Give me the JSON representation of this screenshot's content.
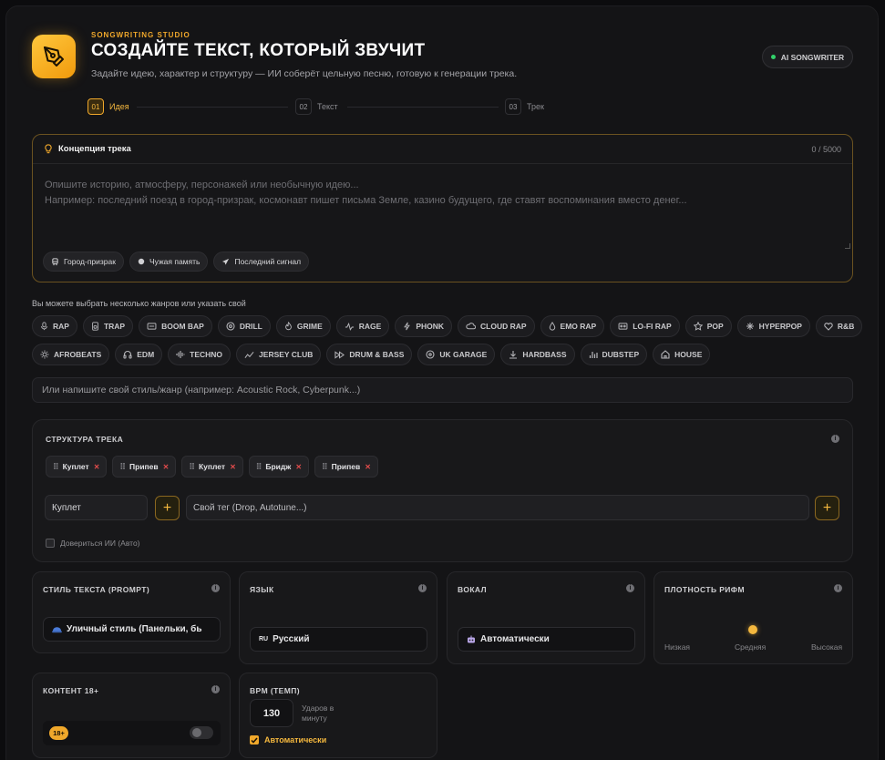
{
  "header": {
    "kicker": "SONGWRITING STUDIO",
    "title": "СОЗДАЙТЕ ТЕКСТ, КОТОРЫЙ ЗВУЧИТ",
    "subtitle": "Задайте идею, характер и структуру — ИИ соберёт цельную песню, готовую к генерации трека.",
    "badge": "AI SONGWRITER"
  },
  "steps": [
    {
      "num": "01",
      "label": "Идея",
      "active": true
    },
    {
      "num": "02",
      "label": "Текст",
      "active": false
    },
    {
      "num": "03",
      "label": "Трек",
      "active": false
    }
  ],
  "concept": {
    "title": "Концепция трека",
    "counter": "0 / 5000",
    "placeholder_line1": "Опишите историю, атмосферу, персонажей или необычную идею...",
    "placeholder_line2": "Например: последний поезд в город-призрак, космонавт пишет письма Земле, казино будущего, где ставят воспоминания вместо денег...",
    "chips": [
      {
        "icon": "train-icon",
        "label": "Город-призрак"
      },
      {
        "icon": "circle-icon",
        "label": "Чужая память"
      },
      {
        "icon": "rocket-icon",
        "label": "Последний сигнал"
      }
    ]
  },
  "genres": {
    "label": "Вы можете выбрать несколько жанров или указать свой",
    "row1": [
      {
        "icon": "mic-icon",
        "label": "RAP"
      },
      {
        "icon": "speaker-icon",
        "label": "TRAP"
      },
      {
        "icon": "boombox-icon",
        "label": "BOOM BAP"
      },
      {
        "icon": "vinyl-icon",
        "label": "DRILL"
      },
      {
        "icon": "flame-icon",
        "label": "GRIME"
      },
      {
        "icon": "pulse-icon",
        "label": "RAGE"
      },
      {
        "icon": "bolt-icon",
        "label": "PHONK"
      },
      {
        "icon": "cloud-icon",
        "label": "CLOUD RAP"
      },
      {
        "icon": "drop-icon",
        "label": "EMO RAP"
      },
      {
        "icon": "cassette-icon",
        "label": "LO-FI RAP"
      },
      {
        "icon": "star-icon",
        "label": "POP"
      },
      {
        "icon": "sparkle-icon",
        "label": "HYPERPOP"
      },
      {
        "icon": "heart-icon",
        "label": "R&B"
      }
    ],
    "row2": [
      {
        "icon": "sun-icon",
        "label": "AFROBEATS"
      },
      {
        "icon": "headphones-icon",
        "label": "EDM"
      },
      {
        "icon": "waveform-icon",
        "label": "TECHNO"
      },
      {
        "icon": "activity-icon",
        "label": "JERSEY CLUB"
      },
      {
        "icon": "fast-forward-icon",
        "label": "DRUM & BASS"
      },
      {
        "icon": "disc-icon",
        "label": "UK GARAGE"
      },
      {
        "icon": "download-icon",
        "label": "HARDBASS"
      },
      {
        "icon": "bars-icon",
        "label": "DUBSTEP"
      },
      {
        "icon": "house-icon",
        "label": "HOUSE"
      }
    ],
    "custom_placeholder": "Или напишите свой стиль/жанр (например: Acoustic Rock, Cyberpunk...)"
  },
  "structure": {
    "title": "СТРУКТУРА ТРЕКА",
    "tags": [
      "Куплет",
      "Припев",
      "Куплет",
      "Бридж",
      "Припев"
    ],
    "section_select": "Куплет",
    "custom_tag_placeholder": "Свой тег (Drop, Autotune...)",
    "auto_label": "Довериться ИИ (Авто)"
  },
  "text_style": {
    "title": "СТИЛЬ ТЕКСТА (PROMPT)",
    "value": "Уличный стиль (Панельки, бь"
  },
  "language": {
    "title": "ЯЗЫК",
    "code": "RU",
    "value": "Русский"
  },
  "vocal": {
    "title": "ВОКАЛ",
    "value": "Автоматически"
  },
  "rhyme_density": {
    "title": "ПЛОТНОСТЬ РИФМ",
    "low": "Низкая",
    "mid": "Средняя",
    "high": "Высокая",
    "level": "Средняя"
  },
  "content18": {
    "title": "КОНТЕНТ 18+",
    "badge": "18+",
    "enabled": false
  },
  "bpm": {
    "title": "BPM (ТЕМП)",
    "value": "130",
    "unit": "Ударов в минуту",
    "auto_label": "Автоматически",
    "auto": true
  },
  "colors": {
    "accent": "#f0a82b",
    "background": "#141416",
    "card": "#18181a",
    "status_green": "#32d16a",
    "remove_red": "#e04b4b"
  }
}
